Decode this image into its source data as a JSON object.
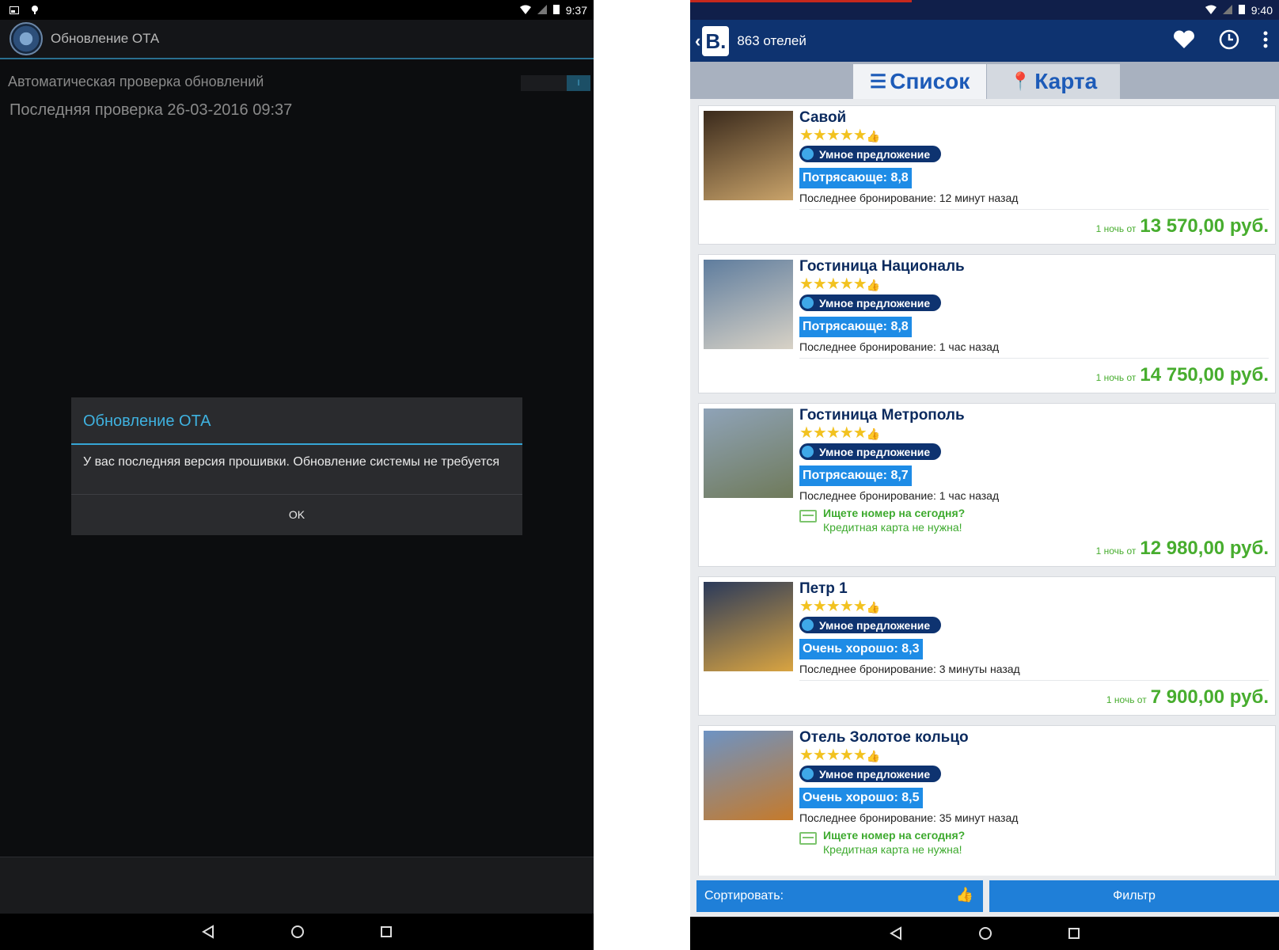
{
  "left": {
    "status": {
      "time": "9:37"
    },
    "app_title": "Обновление ОТА",
    "settings": {
      "auto_check": "Автоматическая проверка обновлений",
      "last_check": "Последняя проверка 26-03-2016 09:37",
      "toggle_state": "I"
    },
    "dialog": {
      "title": "Обновление ОТА",
      "message": "У вас последняя версия прошивки. Обновление системы не требуется",
      "ok": "OK"
    }
  },
  "right": {
    "status": {
      "time": "9:40"
    },
    "header": {
      "logo": "B.",
      "hotel_count": "863 отелей"
    },
    "tabs": [
      {
        "label": "Список"
      },
      {
        "label": "Карта"
      }
    ],
    "hotels": [
      {
        "name": "Савой",
        "stars": "★★★★★",
        "smart": "Умное предложение",
        "score": "Потрясающе: 8,8",
        "last_booking": "Последнее бронирование: 12 минут назад",
        "price_prefix": "1 ночь от",
        "price": "13 570,00 руб.",
        "photo_colors": [
          "#3a2a1c",
          "#c9a36a"
        ]
      },
      {
        "name": "Гостиница Националь",
        "stars": "★★★★★",
        "smart": "Умное предложение",
        "score": "Потрясающе: 8,8",
        "last_booking": "Последнее бронирование: 1 час назад",
        "price_prefix": "1 ночь от",
        "price": "14 750,00 руб.",
        "photo_colors": [
          "#5f7d9e",
          "#d8d2c6"
        ]
      },
      {
        "name": "Гостиница Метрополь",
        "stars": "★★★★★",
        "smart": "Умное предложение",
        "score": "Потрясающе: 8,7",
        "last_booking": "Последнее бронирование: 1 час назад",
        "today_q": "Ищете номер на сегодня?",
        "today_note": "Кредитная карта не нужна!",
        "price_prefix": "1 ночь от",
        "price": "12 980,00 руб.",
        "photo_colors": [
          "#8fa3b8",
          "#6f7a5a"
        ]
      },
      {
        "name": "Петр 1",
        "stars": "★★★★★",
        "smart": "Умное предложение",
        "score": "Очень хорошо: 8,3",
        "last_booking": "Последнее бронирование: 3 минуты назад",
        "price_prefix": "1 ночь от",
        "price": "7 900,00 руб.",
        "photo_colors": [
          "#2b3a5a",
          "#d9a441"
        ]
      },
      {
        "name": "Отель Золотое кольцо",
        "stars": "★★★★★",
        "smart": "Умное предложение",
        "score": "Очень хорошо: 8,5",
        "last_booking": "Последнее бронирование: 35 минут назад",
        "today_q": "Ищете номер на сегодня?",
        "today_note": "Кредитная карта не нужна!",
        "photo_colors": [
          "#6d93c4",
          "#c67a2a"
        ]
      }
    ],
    "bottom": {
      "sort": "Сортировать:",
      "filter": "Фильтр"
    }
  }
}
